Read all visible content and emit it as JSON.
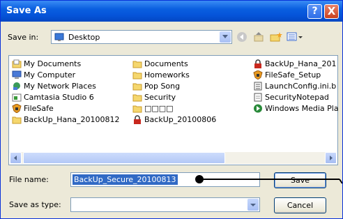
{
  "window": {
    "title": "Save As"
  },
  "titlebar": {
    "help_label": "?",
    "close_label": "X"
  },
  "savein": {
    "label": "Save in:",
    "value": "Desktop"
  },
  "toolbar": {
    "icons": [
      "back-icon",
      "up-folder-icon",
      "new-folder-icon",
      "views-icon"
    ]
  },
  "files": {
    "col1": [
      "My Documents",
      "My Computer",
      "My Network Places",
      "Camtasia Studio 6",
      "FileSafe",
      "BackUp_Hana_20100812"
    ],
    "col2": [
      "Documents",
      "Homeworks",
      "Pop Song",
      "Security",
      "□□□□",
      "BackUp_20100806"
    ],
    "col3": [
      "BackUp_Hana_201",
      "FileSafe_Setup",
      "LaunchConfig.ini.b",
      "SecurityNotepad",
      "Windows Media Pla"
    ]
  },
  "filename": {
    "label": "File name:",
    "value": "BackUp_Secure_20100813"
  },
  "savetype": {
    "label": "Save as type:",
    "value": ""
  },
  "buttons": {
    "save": "Save",
    "cancel": "Cancel"
  }
}
